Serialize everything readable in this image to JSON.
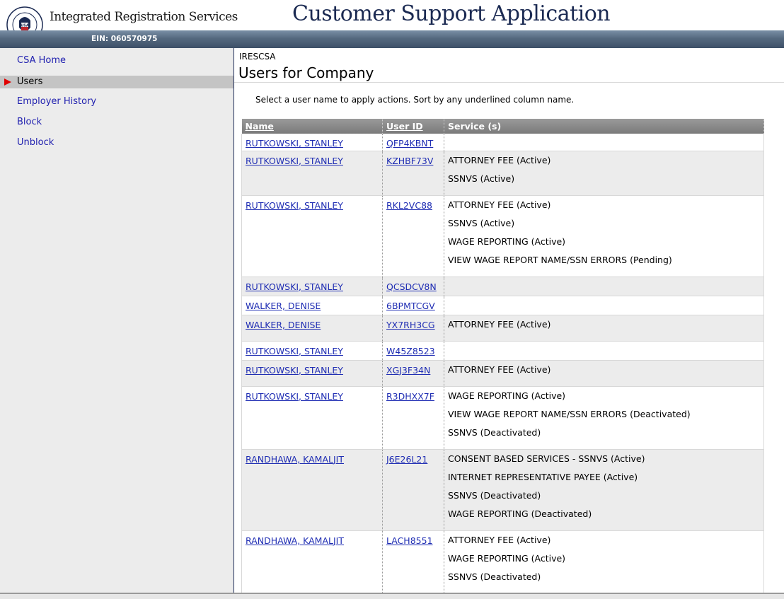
{
  "header": {
    "ssa_name": "Integrated Registration Services",
    "app_title": "Customer Support Application",
    "ein": "EIN: 060570975",
    "logo_text": "SOCIAL SECURITY ADMINISTRATION USA"
  },
  "sidebar": {
    "items": [
      {
        "label": "CSA Home",
        "active": false
      },
      {
        "label": "Users",
        "active": true
      },
      {
        "label": "Employer History",
        "active": false
      },
      {
        "label": "Block",
        "active": false
      },
      {
        "label": "Unblock",
        "active": false
      }
    ]
  },
  "main": {
    "app_code": "IRESCSA",
    "title": "Users for Company",
    "instructions": "Select a user name to apply actions. Sort by any underlined column name.",
    "columns": [
      "Name",
      "User ID",
      "Service (s)"
    ],
    "rows": [
      {
        "name": "RUTKOWSKI, STANLEY",
        "user_id": "QFP4KBNT",
        "services": []
      },
      {
        "name": "RUTKOWSKI, STANLEY",
        "user_id": "KZHBF73V",
        "services": [
          "ATTORNEY FEE (Active)",
          "SSNVS (Active)"
        ]
      },
      {
        "name": "RUTKOWSKI, STANLEY",
        "user_id": "RKL2VC88",
        "services": [
          "ATTORNEY FEE (Active)",
          "SSNVS (Active)",
          "WAGE REPORTING (Active)",
          "VIEW WAGE REPORT NAME/SSN ERRORS (Pending)"
        ]
      },
      {
        "name": "RUTKOWSKI, STANLEY",
        "user_id": "QCSDCV8N",
        "services": []
      },
      {
        "name": "WALKER, DENISE",
        "user_id": "6BPMTCGV",
        "services": []
      },
      {
        "name": "WALKER, DENISE",
        "user_id": "YX7RH3CG",
        "services": [
          "ATTORNEY FEE (Active)"
        ]
      },
      {
        "name": "RUTKOWSKI, STANLEY",
        "user_id": "W45Z8523",
        "services": []
      },
      {
        "name": "RUTKOWSKI, STANLEY",
        "user_id": "XGJ3F34N",
        "services": [
          "ATTORNEY FEE (Active)"
        ]
      },
      {
        "name": "RUTKOWSKI, STANLEY",
        "user_id": "R3DHXX7F",
        "services": [
          "WAGE REPORTING (Active)",
          "VIEW WAGE REPORT NAME/SSN ERRORS (Deactivated)",
          "SSNVS (Deactivated)"
        ]
      },
      {
        "name": "RANDHAWA, KAMALJIT",
        "user_id": "J6E26L21",
        "services": [
          "CONSENT BASED SERVICES - SSNVS (Active)",
          "INTERNET REPRESENTATIVE PAYEE (Active)",
          "SSNVS (Deactivated)",
          "WAGE REPORTING (Deactivated)"
        ]
      },
      {
        "name": "RANDHAWA, KAMALJIT",
        "user_id": "LACH8551",
        "services": [
          "ATTORNEY FEE (Active)",
          "WAGE REPORTING (Active)",
          "SSNVS (Deactivated)"
        ]
      }
    ]
  }
}
